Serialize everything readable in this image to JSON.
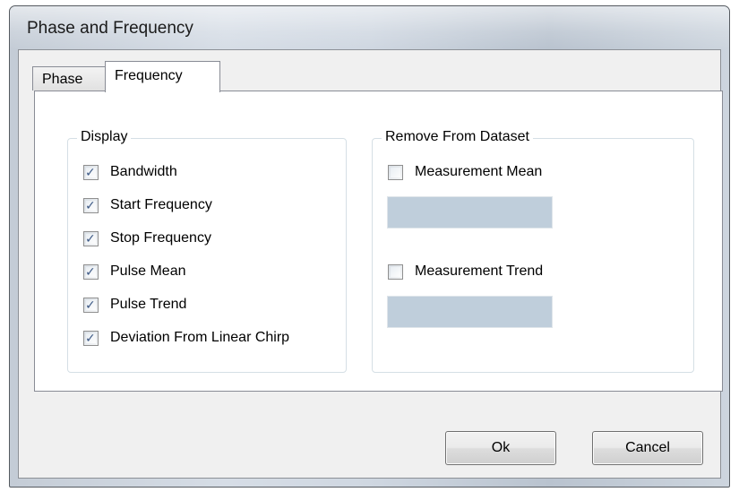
{
  "window": {
    "title": "Phase and Frequency"
  },
  "tabs": [
    {
      "label": "Phase",
      "selected": false
    },
    {
      "label": "Frequency",
      "selected": true
    }
  ],
  "display_group": {
    "label": "Display",
    "items": [
      {
        "label": "Bandwidth",
        "checked": true
      },
      {
        "label": "Start Frequency",
        "checked": true
      },
      {
        "label": "Stop Frequency",
        "checked": true
      },
      {
        "label": "Pulse Mean",
        "checked": true
      },
      {
        "label": "Pulse Trend",
        "checked": true
      },
      {
        "label": "Deviation From Linear Chirp",
        "checked": true
      }
    ]
  },
  "remove_group": {
    "label": "Remove From Dataset",
    "items": [
      {
        "label": "Measurement Mean",
        "checked": false,
        "value": ""
      },
      {
        "label": "Measurement Trend",
        "checked": false,
        "value": ""
      }
    ]
  },
  "buttons": {
    "ok": "Ok",
    "cancel": "Cancel"
  },
  "icons": {
    "checkmark": "checkmark-icon"
  },
  "colors": {
    "disabled_field": "#bfcedb",
    "checkmark": "#3f5a86"
  }
}
